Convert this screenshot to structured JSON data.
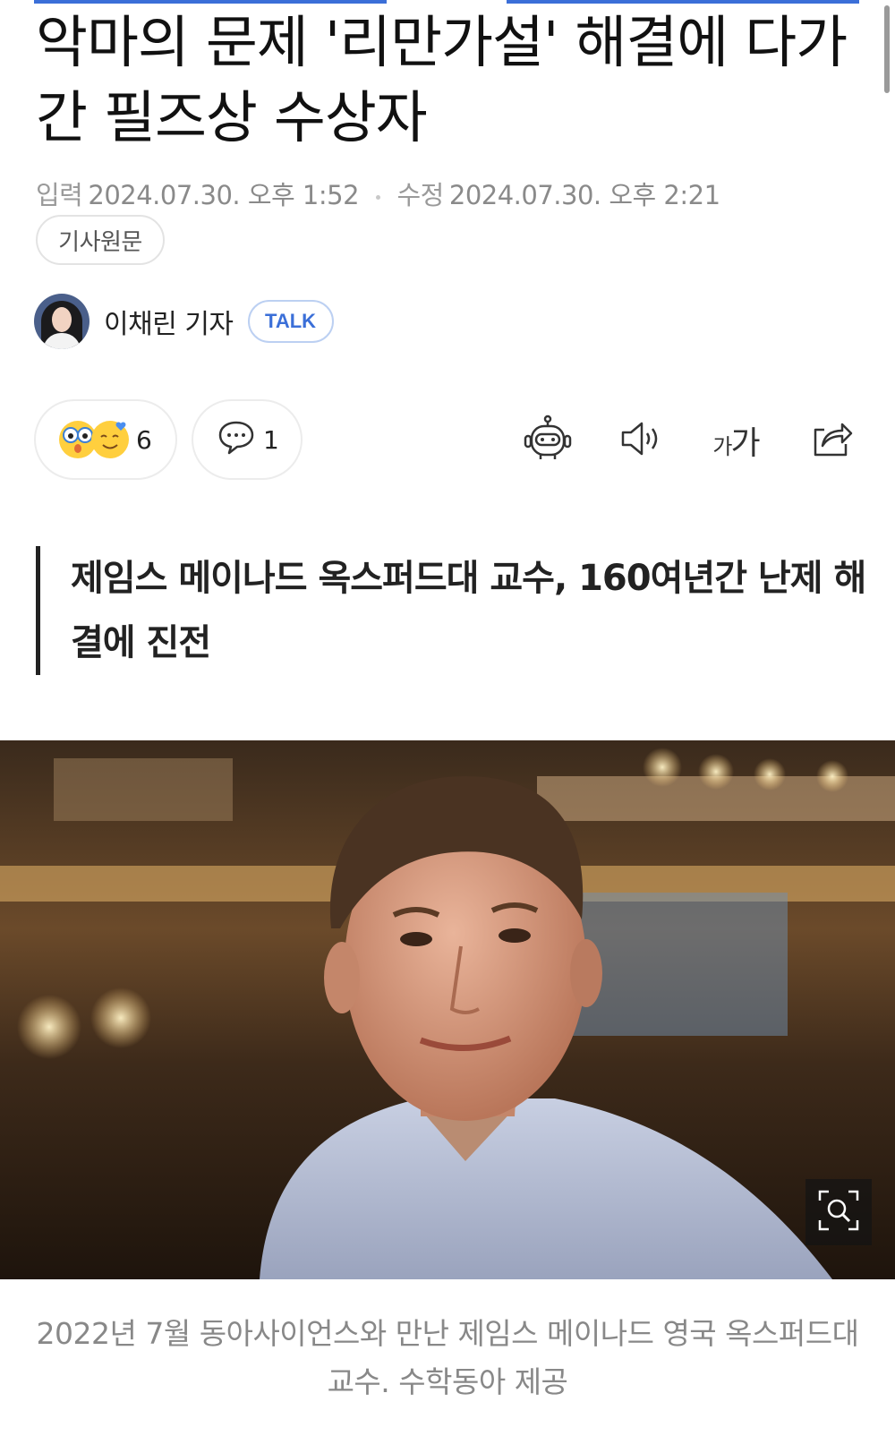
{
  "article": {
    "title": "악마의 문제 '리만가설' 해결에 다가간 필즈상 수상자",
    "meta": {
      "published_label": "입력",
      "published": "2024.07.30. 오후 1:52",
      "modified_label": "수정",
      "modified": "2024.07.30. 오후 2:21"
    },
    "original_button": "기사원문",
    "reporter": {
      "name": "이채린 기자",
      "talk_label": "TALK"
    },
    "reactions": {
      "count": "6",
      "icon": "reaction-emoji-icon"
    },
    "comments": {
      "count": "1",
      "icon": "comment-icon"
    },
    "tools": {
      "summary_icon": "robot-icon",
      "tts_icon": "speaker-icon",
      "font_size_small": "가",
      "font_size_large": "가",
      "share_icon": "share-icon"
    },
    "summary": "제임스 메이나드 옥스퍼드대 교수, 160여년간 난제 해결에 진전",
    "photo": {
      "zoom_icon": "zoom-search-icon",
      "caption": "2022년 7월 동아사이언스와 만난 제임스 메이나드 영국 옥스퍼드대 교수. 수학동아 제공"
    }
  },
  "colors": {
    "accent": "#3b6fd8",
    "meta_text": "#8a8a8a",
    "caption_text": "#888888"
  }
}
